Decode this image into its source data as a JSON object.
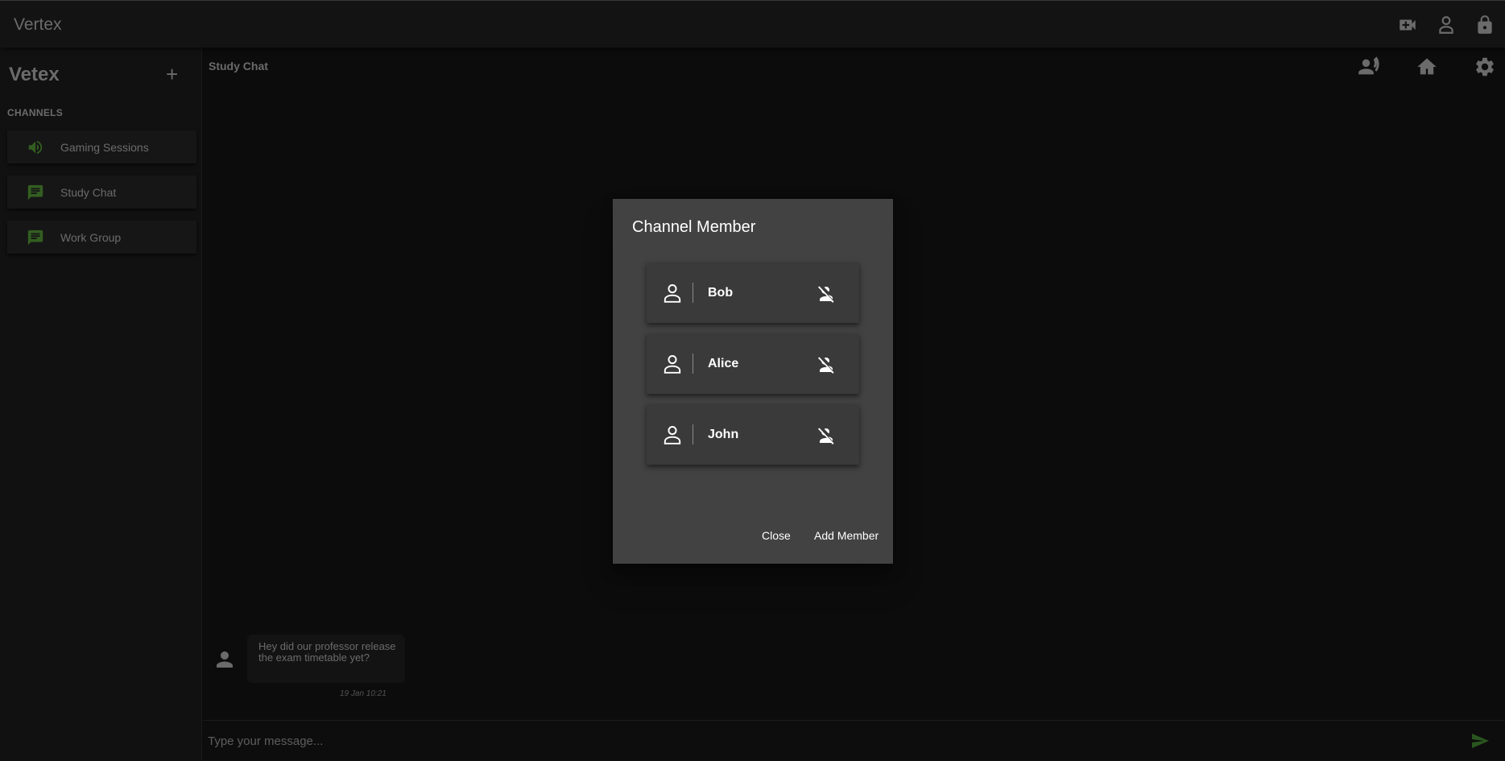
{
  "app": {
    "title": "Vertex"
  },
  "topbar": {
    "icons": [
      "video-add-icon",
      "account-icon",
      "lock-icon"
    ]
  },
  "sidebar": {
    "title": "Vetex",
    "add_icon": "+",
    "section": "CHANNELS",
    "channels": [
      {
        "label": "Gaming Sessions",
        "icon": "speaker-icon"
      },
      {
        "label": "Study Chat",
        "icon": "chat-icon"
      },
      {
        "label": "Work Group",
        "icon": "chat-icon"
      }
    ],
    "accent": "#4c8b31"
  },
  "chat": {
    "title": "Study Chat",
    "header_icons": [
      "members-icon",
      "home-icon",
      "gear-icon"
    ],
    "messages": [
      {
        "text": "Hey did our professor release the exam timetable yet?",
        "time": "19 Jan 10:21"
      }
    ],
    "composer_placeholder": "Type your message..."
  },
  "dialog": {
    "title": "Channel Member",
    "members": [
      {
        "name": "Bob"
      },
      {
        "name": "Alice"
      },
      {
        "name": "John"
      }
    ],
    "close_label": "Close",
    "add_label": "Add Member"
  }
}
